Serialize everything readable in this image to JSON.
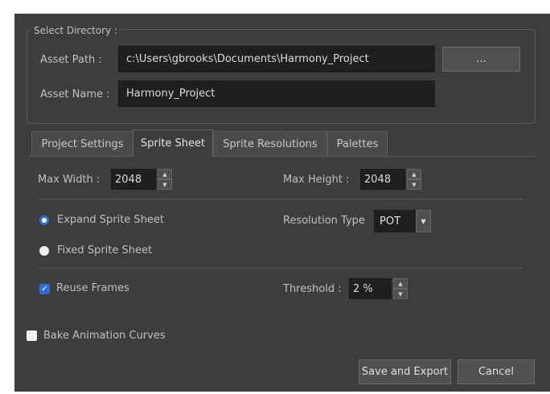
{
  "select_directory": {
    "title": "Select Directory :",
    "asset_path_label": "Asset Path :",
    "asset_path_value": "c:\\Users\\gbrooks\\Documents\\Harmony_Project",
    "browse_label": "...",
    "asset_name_label": "Asset Name :",
    "asset_name_value": "Harmony_Project"
  },
  "tabs": [
    {
      "label": "Project Settings",
      "active": false
    },
    {
      "label": "Sprite Sheet",
      "active": true
    },
    {
      "label": "Sprite Resolutions",
      "active": false
    },
    {
      "label": "Palettes",
      "active": false
    }
  ],
  "sprite_sheet": {
    "max_width_label": "Max Width :",
    "max_width_value": "2048",
    "max_height_label": "Max Height :",
    "max_height_value": "2048",
    "expand_label": "Expand Sprite Sheet",
    "fixed_label": "Fixed Sprite Sheet",
    "selected_mode": "Expand Sprite Sheet",
    "resolution_type_label": "Resolution Type",
    "resolution_type_value": "POT",
    "reuse_frames_label": "Reuse Frames",
    "reuse_frames_checked": true,
    "threshold_label": "Threshold :",
    "threshold_value": "2 %"
  },
  "bake_animation_curves_label": "Bake Animation Curves",
  "bake_animation_curves_checked": false,
  "buttons": {
    "save_export": "Save and Export",
    "cancel": "Cancel"
  },
  "colors": {
    "background": "#3d3d3d",
    "accent": "#2d6fd6",
    "field": "#1f1f1f"
  }
}
